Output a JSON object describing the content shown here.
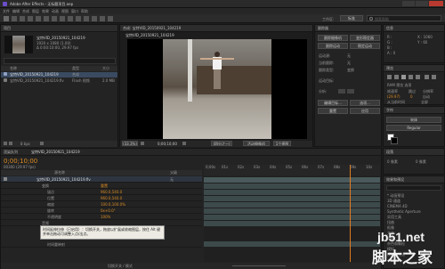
{
  "titlebar": {
    "title": "Adobe After Effects - 无标题项目.aep"
  },
  "menubar": {
    "items": [
      "文件",
      "编辑",
      "合成",
      "图层",
      "效果",
      "动画",
      "视图",
      "窗口",
      "帮助"
    ]
  },
  "toolbar": {
    "workspace_label": "工作区:",
    "workspace_value": "标准",
    "search_placeholder": "搜索帮助"
  },
  "project": {
    "title": "项目",
    "comp_name": "宝特VID_20150921_104219",
    "info_line1": "1920 x 1080 (1.00)",
    "info_line2": "Δ 0:00:10:00, 29.97 fps",
    "col_name": "名称",
    "col_type": "类型",
    "col_size": "大小",
    "items": [
      {
        "name": "宝特VID_20150921_104219",
        "type": "合成",
        "size": ""
      },
      {
        "name": "宝特VID_20150921_104219.flv",
        "type": "Flash 视频",
        "size": "2.0 MB"
      }
    ],
    "bpc": "8 bpc"
  },
  "composition": {
    "tab": "合成: 宝特VID_20150921_104219",
    "subtab": "宝特VID_20150921_104219",
    "zoom": "(33.3%)",
    "timecode": "0;00;10;00",
    "quality": "(四分之一)",
    "camera": "活动摄像机",
    "views": "1个视图"
  },
  "info_panel": {
    "title": "信息",
    "x": "X : 1060",
    "y": "Y : 60",
    "r": "R :",
    "g": "G :",
    "b": "B :",
    "a": "A : 0"
  },
  "tracker": {
    "title": "跟踪器",
    "buttons": [
      "跟踪摄像机",
      "变形稳定器",
      "跟踪运动",
      "稳定运动"
    ],
    "labels": [
      "运动源:",
      "当前跟踪:",
      "跟踪类型:",
      "运动目标:",
      "分析:"
    ],
    "values": [
      "无",
      "无",
      "变换",
      "",
      ""
    ],
    "footer_buttons": [
      "编辑目标...",
      "选项...",
      "重置",
      "应用"
    ]
  },
  "preview": {
    "title": "预览",
    "ram_label": "RAM 预览 选项",
    "frame_rate": "帧速率",
    "skip": "跳过",
    "resolution": "分辨率",
    "fps_value": "(29.97)",
    "skip_value": "0",
    "res_value": "自动",
    "from_label": "从当前时间",
    "full_label": "全屏"
  },
  "character": {
    "title": "字符",
    "font": "宋体",
    "size": "Regular"
  },
  "paragraph": {
    "title": "段落",
    "left_val": "0 像素",
    "right_val": "0 像素"
  },
  "timeline": {
    "tab": "宝特VID_20150921_104219",
    "render_tab": "渲染队列",
    "current_time": "0;00;10;00",
    "frames": "00300 (29.97 fps)",
    "col_source": "源名称",
    "col_mode": "父级",
    "layer_name": "宝特VID_20150921_104219.flv",
    "parent": "无",
    "transform": "变换",
    "reset": "重置",
    "props": [
      {
        "name": "锚点",
        "value": "960.0,540.0"
      },
      {
        "name": "位置",
        "value": "960.0,540.0"
      },
      {
        "name": "缩放",
        "value": "100.0,100.0%"
      },
      {
        "name": "旋转",
        "value": "0x+0.0°"
      },
      {
        "name": "不透明度",
        "value": "100%"
      }
    ],
    "audio": "音频",
    "time_remap": "时间重映射",
    "tooltip": "时间延伸拉伸（已启用）：切换开关，拖放以扩展或收缩图层，按住 Alt 键并单击拖动可调整入点/出点。",
    "ruler": [
      "0;00s",
      "01s",
      "02s",
      "03s",
      "04s",
      "05s",
      "06s",
      "07s",
      "08s",
      "09s",
      "10s"
    ],
    "toggle_label": "切换开关 / 模式",
    "playhead_frac": 0.83
  },
  "effects": {
    "title": "效果和预设",
    "search_placeholder": "",
    "items": [
      "* 动画预设",
      "3D 通道",
      "CINEMA 4D",
      "Synthetic Aperture",
      "实用工具",
      "扭曲",
      "抠像",
      "文本",
      "时间",
      "杂色和颗粒",
      "模拟",
      "模糊和锐化"
    ]
  },
  "watermark": {
    "line1": "jb51.net",
    "line2": "脚本之家"
  },
  "colors": {
    "accent": "#d98b24",
    "track": "#3d4a4c",
    "playhead": "#e07b22"
  }
}
